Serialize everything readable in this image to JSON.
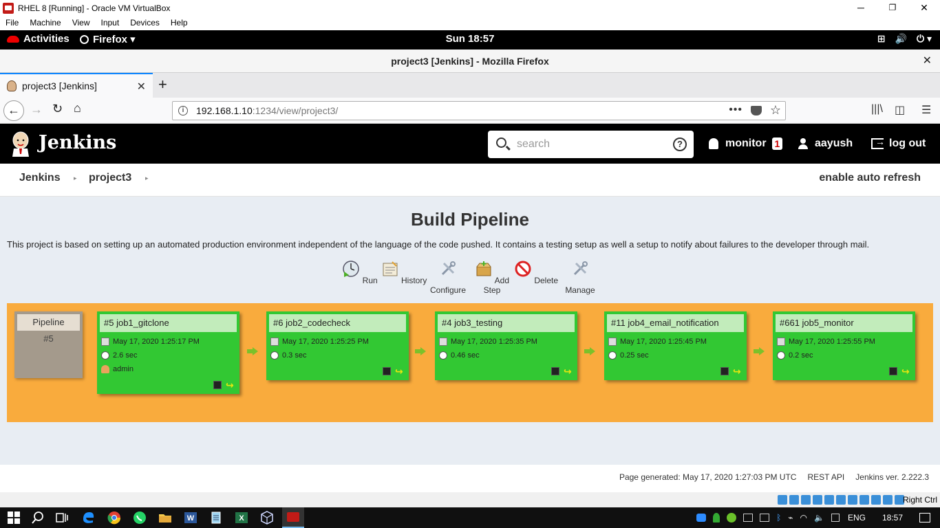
{
  "vbox": {
    "title": "RHEL 8 [Running] - Oracle VM VirtualBox",
    "menu": [
      "File",
      "Machine",
      "View",
      "Input",
      "Devices",
      "Help"
    ],
    "minimize": "─",
    "restore": "❐",
    "close": "✕",
    "host_key": "Right Ctrl"
  },
  "gnome": {
    "activities": "Activities",
    "app": "Firefox ▾",
    "clock": "Sun 18:57",
    "tray": [
      "⊞",
      "🔊",
      "⏻ ▾"
    ]
  },
  "firefox": {
    "window_title": "project3 [Jenkins] - Mozilla Firefox",
    "close": "✕",
    "tab_title": "project3 [Jenkins]",
    "tab_close": "✕",
    "new_tab": "+",
    "url_host": "192.168.1.10",
    "url_rest": ":1234/view/project3/",
    "back": "←",
    "forward": "→",
    "reload": "↻",
    "home": "⌂",
    "url_menu": "•••",
    "bookmark": "☆",
    "right_icons": [
      "|||\\",
      "◫",
      "☰"
    ]
  },
  "jenkins": {
    "brand": "Jenkins",
    "search_placeholder": "search",
    "help": "?",
    "notifications_label": "monitor",
    "notifications_count": "1",
    "user": "aayush",
    "logout": "log out",
    "breadcrumbs": [
      "Jenkins",
      "project3"
    ],
    "crumb_sep": "▸",
    "auto_refresh": "enable auto refresh",
    "page_title": "Build Pipeline",
    "description": "This project is based on setting up an automated production environment independent of the language of the code pushed. It contains a testing setup as well a setup to notify about failures to the developer through mail.",
    "actions": [
      "Run",
      "History",
      "Configure",
      "Add Step",
      "Delete",
      "Manage"
    ],
    "pipeline_label": "Pipeline",
    "pipeline_number": "#5",
    "jobs": [
      {
        "name": "#5 job1_gitclone",
        "date": "May 17, 2020 1:25:17 PM",
        "duration": "2.6 sec",
        "user": "admin"
      },
      {
        "name": "#6 job2_codecheck",
        "date": "May 17, 2020 1:25:25 PM",
        "duration": "0.3 sec"
      },
      {
        "name": "#4 job3_testing",
        "date": "May 17, 2020 1:25:35 PM",
        "duration": "0.46 sec"
      },
      {
        "name": "#11 job4_email_notification",
        "date": "May 17, 2020 1:25:45 PM",
        "duration": "0.25 sec"
      },
      {
        "name": "#661 job5_monitor",
        "date": "May 17, 2020 1:25:55 PM",
        "duration": "0.2 sec"
      }
    ],
    "footer": {
      "generated": "Page generated: May 17, 2020 1:27:03 PM UTC",
      "rest_api": "REST API",
      "version": "Jenkins ver. 2.222.3"
    },
    "colors": {
      "success": "#32c833",
      "pipeline_bg": "#f9ab3d",
      "header_bg": "#000000"
    }
  },
  "taskbar": {
    "lang": "ENG",
    "time": "18:57"
  }
}
